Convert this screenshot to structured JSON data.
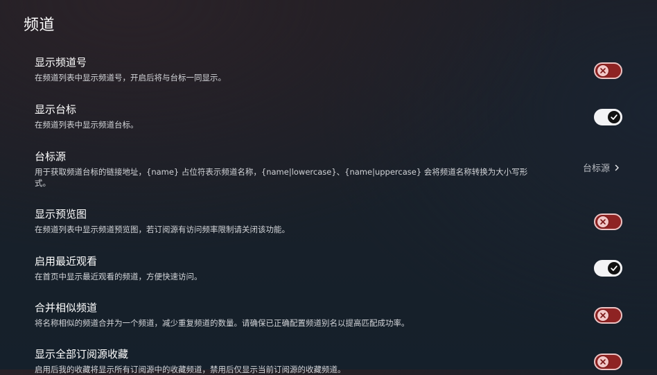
{
  "page": {
    "title": "频道"
  },
  "settings": [
    {
      "title": "显示频道号",
      "desc": "在频道列表中显示频道号，开启后将与台标一同显示。",
      "state": "off"
    },
    {
      "title": "显示台标",
      "desc": "在频道列表中显示频道台标。",
      "state": "on"
    },
    {
      "title": "台标源",
      "desc": "用于获取频道台标的链接地址，{name} 占位符表示频道名称，{name|lowercase}、{name|uppercase} 会将频道名称转换为大小写形式。",
      "value": "台标源"
    },
    {
      "title": "显示预览图",
      "desc": "在频道列表中显示频道预览图，若订阅源有访问频率限制请关闭该功能。",
      "state": "off"
    },
    {
      "title": "启用最近观看",
      "desc": "在首页中显示最近观看的频道，方便快速访问。",
      "state": "on"
    },
    {
      "title": "合并相似频道",
      "desc": "将名称相似的频道合并为一个频道，减少重复频道的数量。请确保已正确配置频道别名以提高匹配成功率。",
      "state": "off"
    },
    {
      "title": "显示全部订阅源收藏",
      "desc": "启用后我的收藏将显示所有订阅源中的收藏频道，禁用后仅显示当前订阅源的收藏频道。",
      "state": "off"
    }
  ],
  "icons": {
    "off": "close-icon",
    "on": "check-icon",
    "chevron": "chevron-right-icon"
  },
  "colors": {
    "toggle_off_track": "#8e2323",
    "toggle_off_border": "#ecc3c3",
    "toggle_on_track": "#f3f3f5",
    "toggle_on_knob": "#111111"
  }
}
